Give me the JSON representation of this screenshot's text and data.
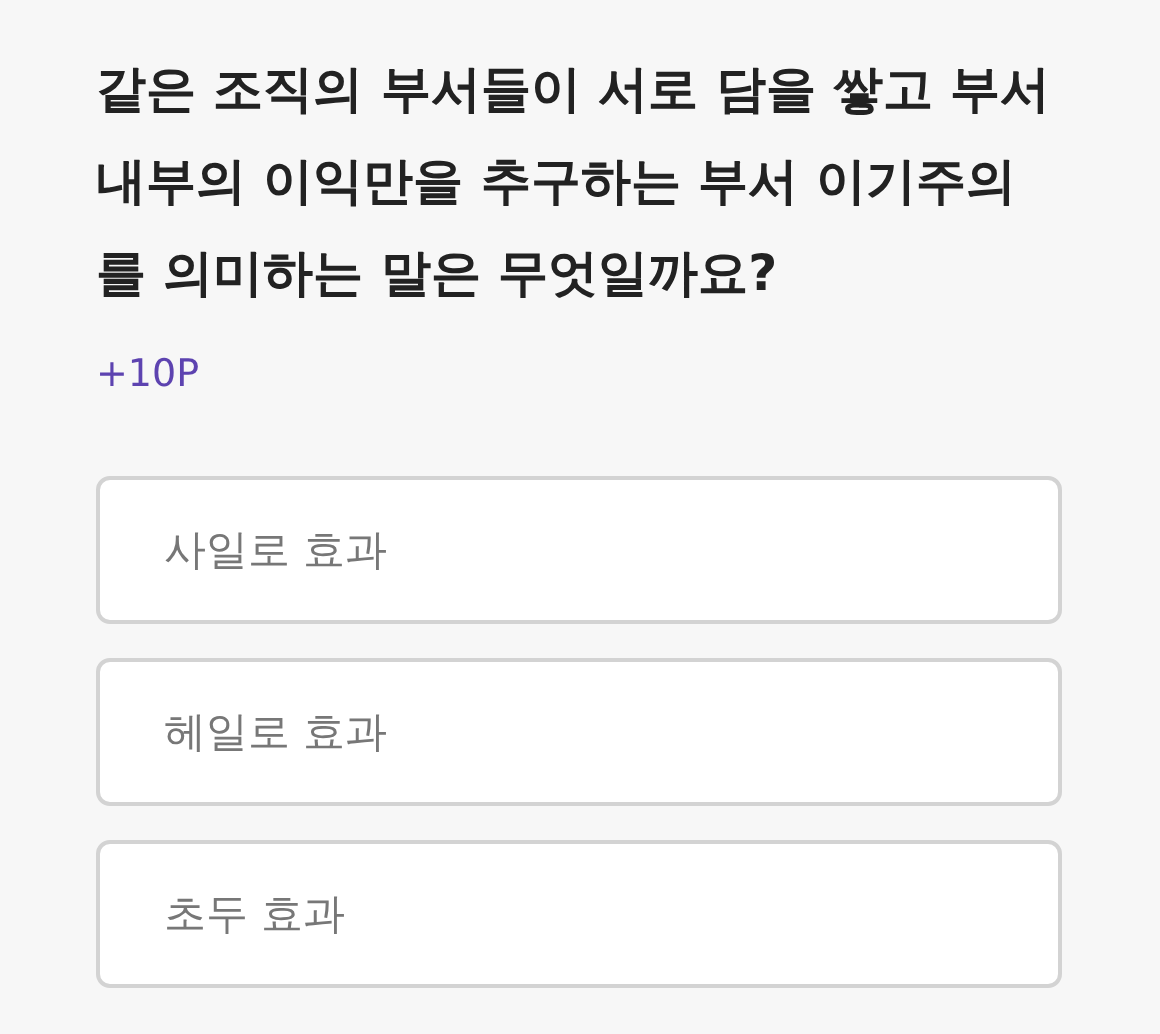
{
  "question": "같은 조직의 부서들이 서로 담을 쌓고 부서 내부의 이익만을 추구하는 부서 이기주의를 의미하는 말은 무엇일까요?",
  "points": "+10P",
  "options": [
    {
      "label": "사일로 효과",
      "selected": false
    },
    {
      "label": "헤일로 효과",
      "selected": false
    },
    {
      "label": "초두 효과",
      "selected": false
    }
  ]
}
